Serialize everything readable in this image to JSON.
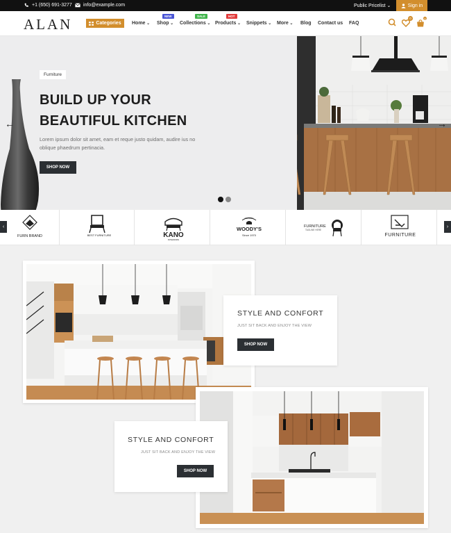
{
  "topbar": {
    "phone": "+1 (650) 691-3277",
    "email": "info@example.com",
    "pricelist": "Public Pricelist",
    "signin": "Sign in"
  },
  "header": {
    "logo": "ALAN",
    "categories": "Categories",
    "nav": [
      {
        "label": "Home",
        "dropdown": true
      },
      {
        "label": "Shop",
        "dropdown": true,
        "badge": "NEW",
        "badge_color": "#4a55d6"
      },
      {
        "label": "Collections",
        "dropdown": true,
        "badge": "SALE",
        "badge_color": "#3fb44a"
      },
      {
        "label": "Products",
        "dropdown": true,
        "badge": "HOT",
        "badge_color": "#e23b3b"
      },
      {
        "label": "Snippets",
        "dropdown": true
      },
      {
        "label": "More",
        "dropdown": true
      },
      {
        "label": "Blog",
        "dropdown": false
      },
      {
        "label": "Contact us",
        "dropdown": false
      },
      {
        "label": "FAQ",
        "dropdown": false
      }
    ],
    "wishlist_count": "0",
    "cart_count": "0"
  },
  "hero": {
    "tag": "Furniture",
    "title_line1": "BUILD UP YOUR",
    "title_line2": "BEAUTIFUL KITCHEN",
    "description": "Lorem ipsum dolor sit amet, eam et reque justo quidam, audire ius no oblique phaedrum pertinacia.",
    "button": "SHOP NOW",
    "prev": "←",
    "next": "→"
  },
  "brands": {
    "items": [
      "FURN BRAND",
      "BEST FURNITURE",
      "KANO",
      "INTERIORS",
      "WOODY'S",
      "Since 1970",
      "FURNITURE",
      "TAGLINE HERE",
      "FURNITURE"
    ],
    "woodys_arc": "CLASSIC",
    "prev": "‹",
    "next": "›"
  },
  "feature1": {
    "title": "STYLE AND CONFORT",
    "subtitle": "JUST SIT BACK AND ENJOY THE VIEW",
    "button": "SHOP NOW"
  },
  "feature2": {
    "title": "STYLE AND CONFORT",
    "subtitle": "JUST SIT BACK AND ENJOY THE VIEW",
    "button": "SHOP NOW"
  },
  "colors": {
    "accent": "#d28e2d",
    "dark_button": "#2b2f33",
    "topbar": "#111111"
  }
}
